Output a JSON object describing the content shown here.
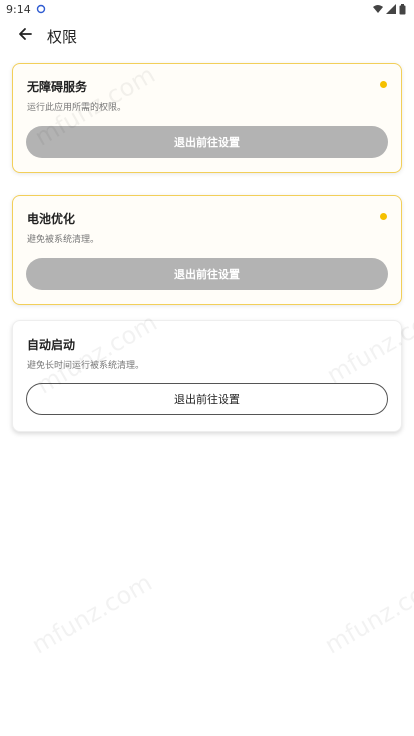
{
  "status_bar": {
    "time": "9:14",
    "icons": [
      "sync-icon",
      "wifi-icon",
      "signal-icon",
      "battery-icon"
    ]
  },
  "app_bar": {
    "title": "权限",
    "back_icon": "arrow-left-icon"
  },
  "cards": [
    {
      "title": "无障碍服务",
      "description": "运行此应用所需的权限。",
      "button_label": "退出前往设置",
      "active": true
    },
    {
      "title": "电池优化",
      "description": "避免被系统清理。",
      "button_label": "退出前往设置",
      "active": true
    },
    {
      "title": "自动启动",
      "description": "避免长时间运行被系统清理。",
      "button_label": "退出前往设置",
      "active": false
    }
  ],
  "watermark_text": "mfunz.com",
  "colors": {
    "accent": "#f5c000",
    "card_border": "#f2cf59",
    "disabled_button": "#b3b3b3"
  }
}
